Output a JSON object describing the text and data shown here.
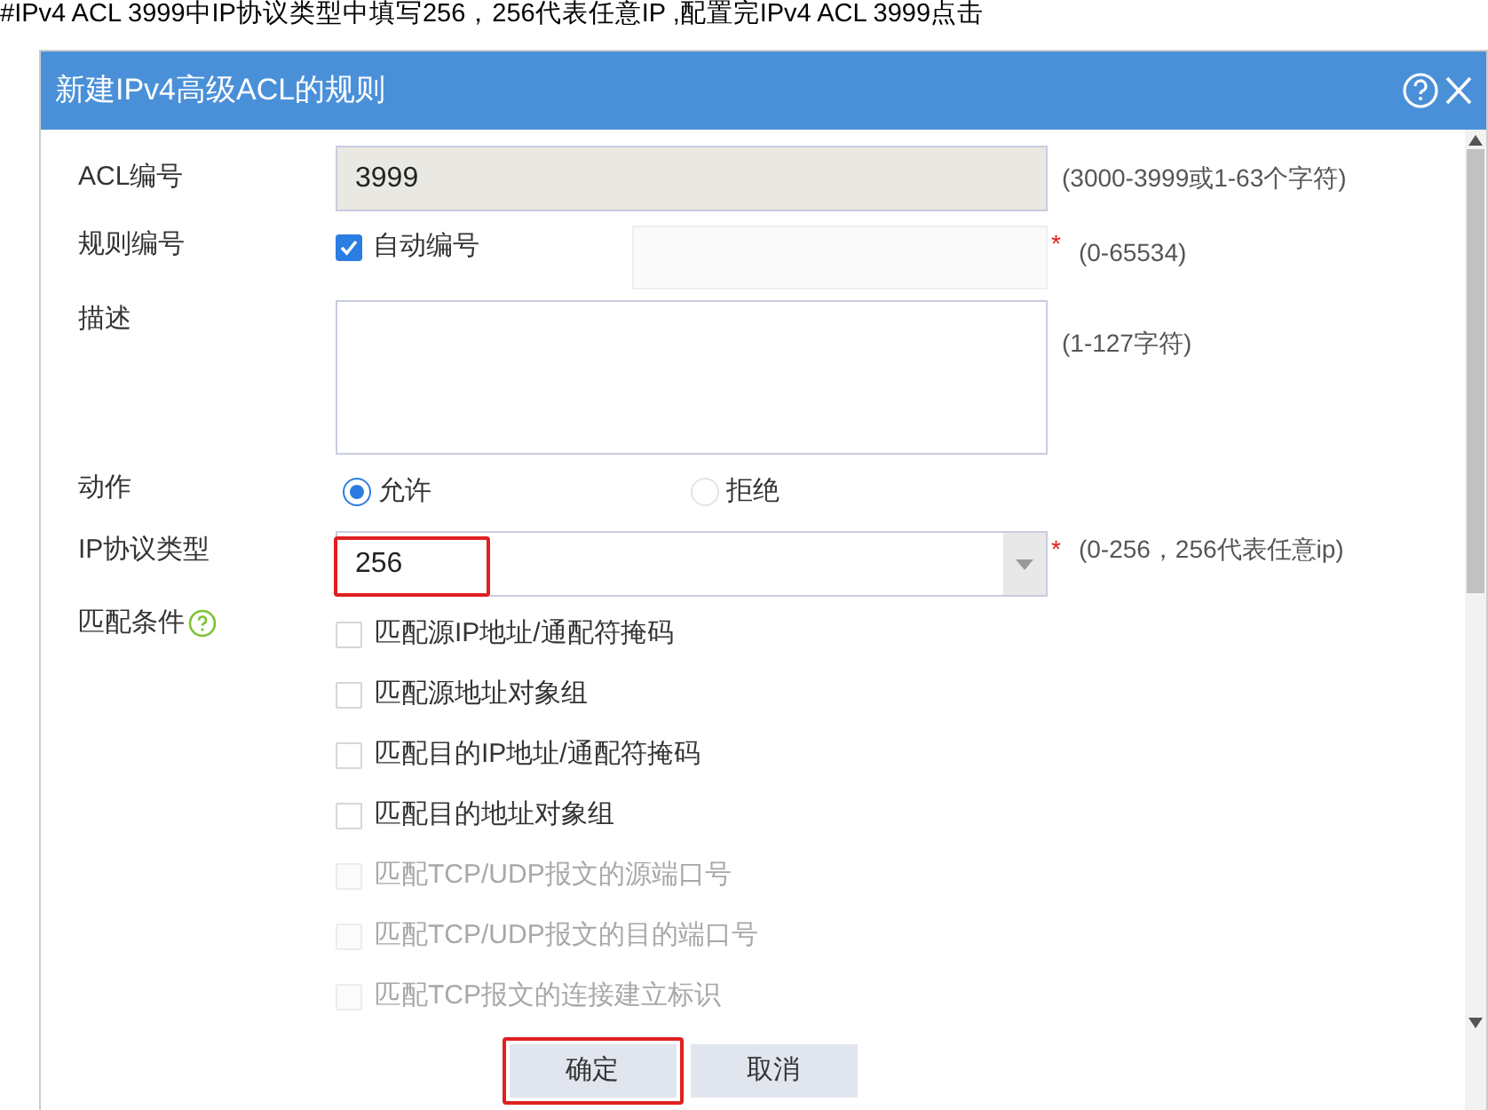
{
  "caption": "#IPv4 ACL 3999中IP协议类型中填写256，256代表任意IP ,配置完IPv4 ACL 3999点击",
  "dialog": {
    "title": "新建IPv4高级ACL的规则",
    "acl_number": {
      "label": "ACL编号",
      "value": "3999",
      "hint": "(3000-3999或1-63个字符)"
    },
    "rule_number": {
      "label": "规则编号",
      "auto": {
        "label": "自动编号",
        "checked": true
      },
      "required": "*",
      "hint": "(0-65534)"
    },
    "description": {
      "label": "描述",
      "hint": "(1-127字符)"
    },
    "action": {
      "label": "动作",
      "options": [
        {
          "label": "允许",
          "selected": true
        },
        {
          "label": "拒绝",
          "selected": false
        }
      ]
    },
    "ip_protocol": {
      "label": "IP协议类型",
      "value": "256",
      "highlighted": true,
      "required": "*",
      "hint": "(0-256，256代表任意ip)"
    },
    "match": {
      "label": "匹配条件",
      "conditions": [
        {
          "label": "匹配源IP地址/通配符掩码",
          "checked": false,
          "disabled": false
        },
        {
          "label": "匹配源地址对象组",
          "checked": false,
          "disabled": false
        },
        {
          "label": "匹配目的IP地址/通配符掩码",
          "checked": false,
          "disabled": false
        },
        {
          "label": "匹配目的地址对象组",
          "checked": false,
          "disabled": false
        },
        {
          "label": "匹配TCP/UDP报文的源端口号",
          "checked": false,
          "disabled": true
        },
        {
          "label": "匹配TCP/UDP报文的目的端口号",
          "checked": false,
          "disabled": true
        },
        {
          "label": "匹配TCP报文的连接建立标识",
          "checked": false,
          "disabled": true
        }
      ]
    },
    "buttons": [
      {
        "label": "确定",
        "highlighted": true
      },
      {
        "label": "取消",
        "highlighted": false
      }
    ]
  }
}
